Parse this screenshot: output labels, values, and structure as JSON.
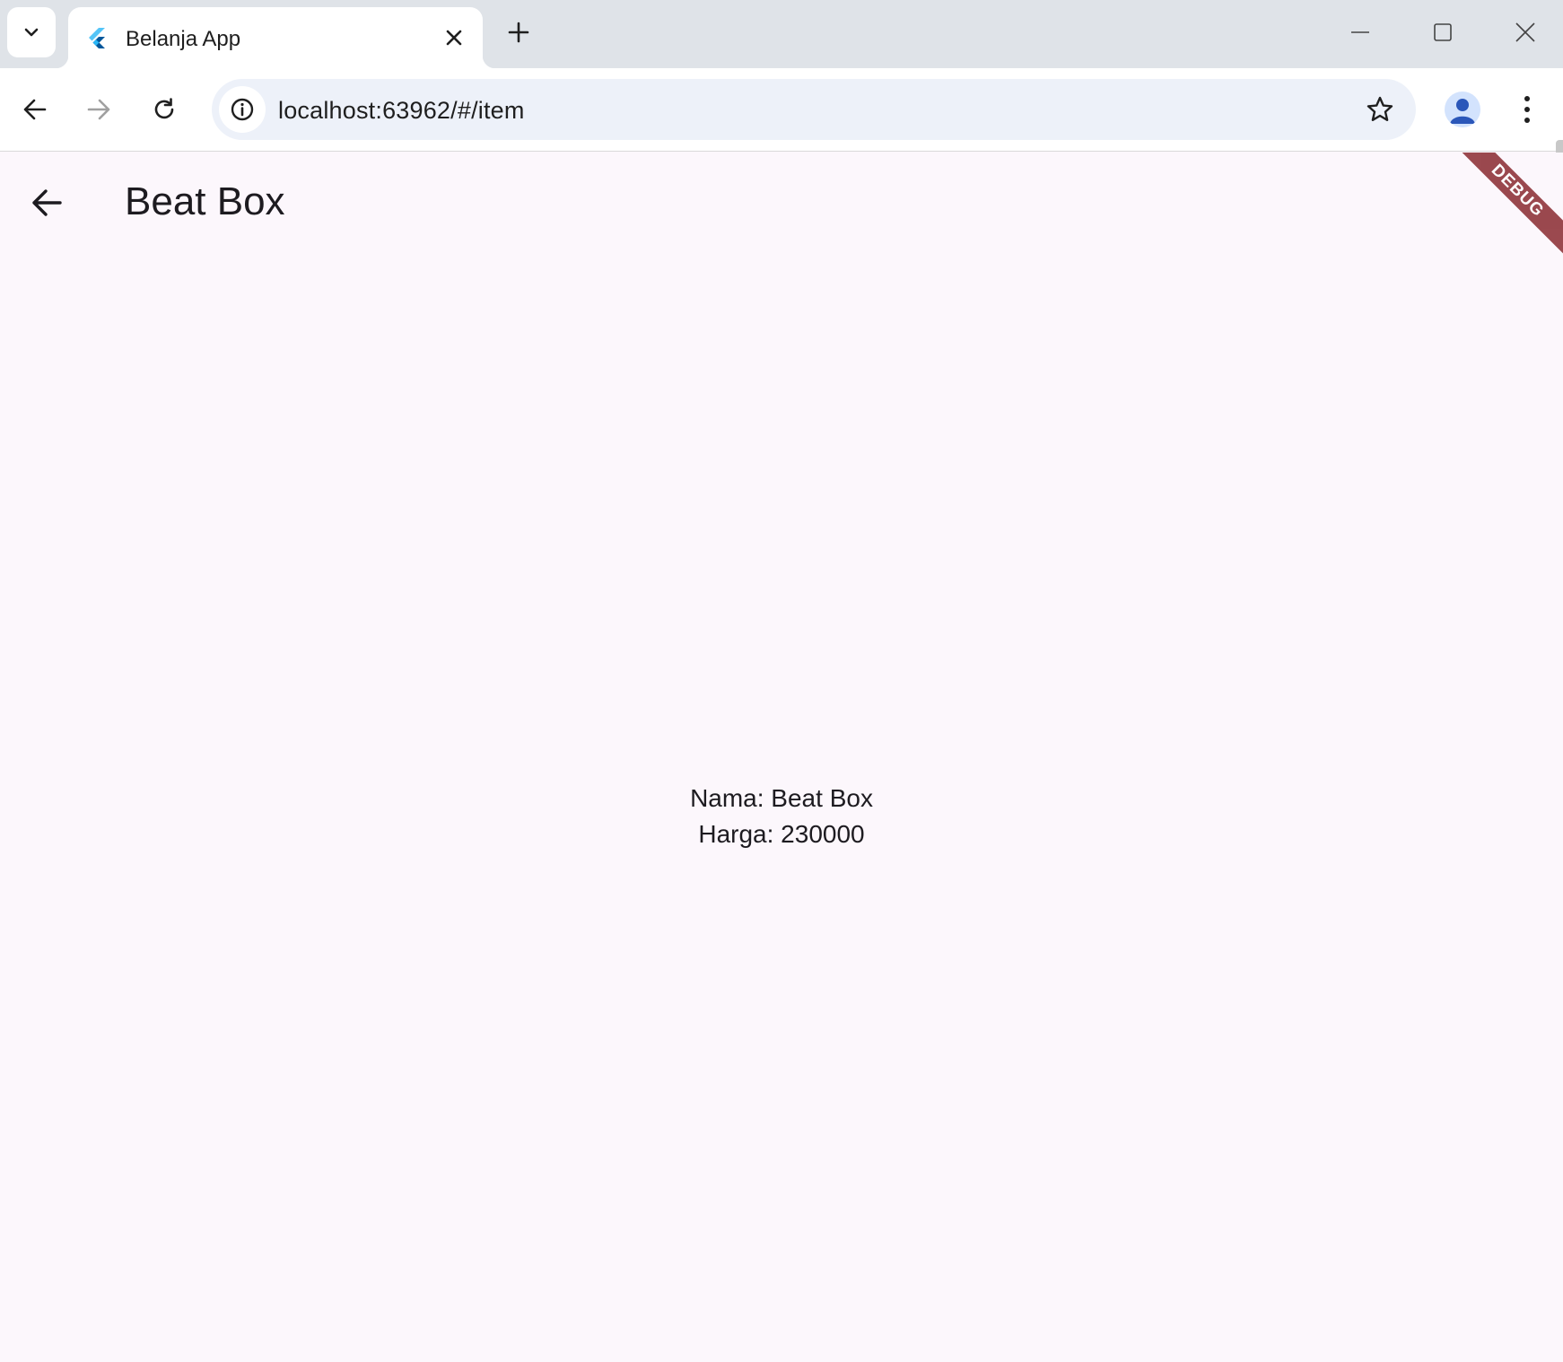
{
  "browser": {
    "tab": {
      "title": "Belanja App",
      "favicon": "flutter-logo-icon"
    },
    "address_bar": {
      "url": "localhost:63962/#/item"
    },
    "icons": {
      "tab_search": "chevron-down-icon",
      "tab_close": "close-icon",
      "new_tab": "plus-icon",
      "minimize": "minimize-icon",
      "maximize": "maximize-icon",
      "close": "close-icon",
      "back": "arrow-left-icon",
      "forward": "arrow-right-icon",
      "reload": "reload-icon",
      "site_info": "info-icon",
      "bookmark": "star-icon",
      "profile": "person-icon",
      "menu": "more-vert-icon"
    }
  },
  "app": {
    "appbar": {
      "title": "Beat Box",
      "back_icon": "arrow-left-icon"
    },
    "debug_banner": "DEBUG",
    "item": {
      "name_line": "Nama: Beat Box",
      "price_line": "Harga: 230000"
    }
  },
  "colors": {
    "page_background": "#fcf7fc",
    "tabstrip": "#dfe3e8",
    "omnibox": "#edf1f9",
    "debug_banner": "#8a2a30",
    "profile_avatar": "#d3e3fd"
  }
}
